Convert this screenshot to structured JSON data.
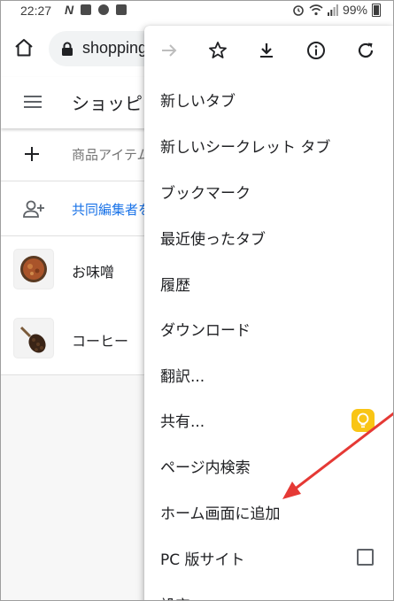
{
  "status_bar": {
    "time": "22:27",
    "n_icon": "N",
    "battery": "99%",
    "icons": [
      "notification-icon",
      "photo-icon",
      "alarm-icon",
      "wifi-icon",
      "signal-icon",
      "battery-icon"
    ]
  },
  "browser": {
    "url": "shopping"
  },
  "app": {
    "title": "ショッピ",
    "add_item_placeholder": "商品アイテム",
    "collaborators_text": "共同編集者を",
    "items": [
      {
        "label": "お味噌",
        "icon": "miso-thumbnail"
      },
      {
        "label": "コーヒー",
        "icon": "coffee-beans-thumbnail"
      }
    ]
  },
  "menu": {
    "toolbar_icons": [
      "forward-icon",
      "star-icon",
      "download-icon",
      "info-icon",
      "refresh-icon"
    ],
    "items": [
      {
        "label": "新しいタブ"
      },
      {
        "label": "新しいシークレット タブ"
      },
      {
        "label": "ブックマーク"
      },
      {
        "label": "最近使ったタブ"
      },
      {
        "label": "履歴"
      },
      {
        "label": "ダウンロード"
      },
      {
        "label": "翻訳..."
      },
      {
        "label": "共有..."
      },
      {
        "label": "ページ内検索"
      },
      {
        "label": "ホーム画面に追加"
      },
      {
        "label": "PC 版サイト"
      },
      {
        "label": "設定"
      }
    ]
  },
  "colors": {
    "accent_link": "#1a73e8",
    "annotation_arrow": "#e53935",
    "lightbulb": "#f9c515"
  }
}
